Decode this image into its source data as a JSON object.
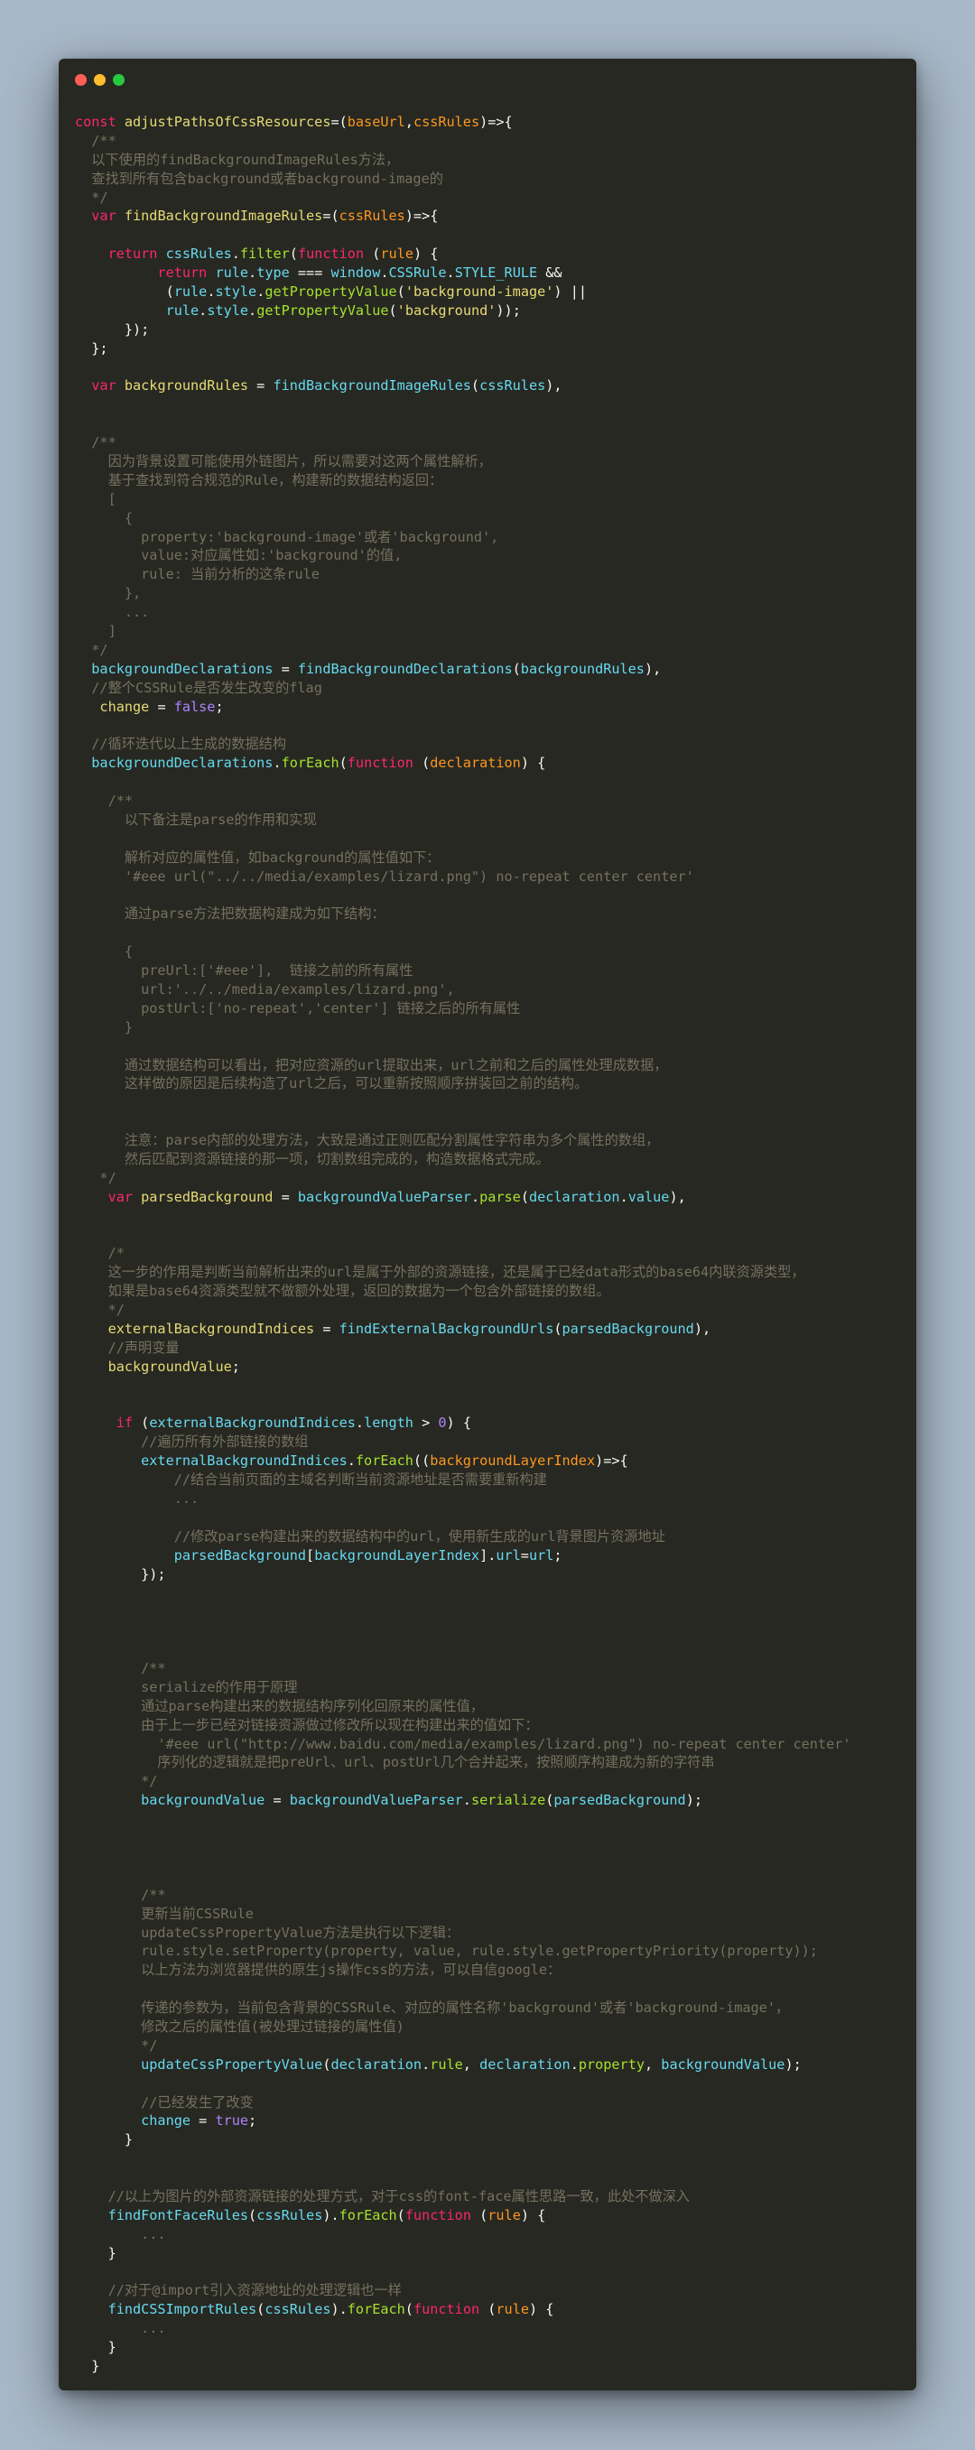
{
  "window": {
    "controls": [
      "close",
      "minimize",
      "maximize"
    ],
    "colors": {
      "close": "#ff5f56",
      "minimize": "#ffbd2e",
      "maximize": "#27c93f",
      "background": "#272822"
    }
  },
  "code": {
    "lines": [
      [
        [
          "kw",
          "const "
        ],
        [
          "ident",
          "adjustPathsOfCssResources"
        ],
        [
          "plain",
          "=("
        ],
        [
          "param",
          "baseUrl"
        ],
        [
          "plain",
          ","
        ],
        [
          "param",
          "cssRules"
        ],
        [
          "plain",
          ")=>{"
        ]
      ],
      [
        [
          "com",
          "  /**"
        ]
      ],
      [
        [
          "com",
          "  以下使用的findBackgroundImageRules方法，"
        ]
      ],
      [
        [
          "com",
          "  查找到所有包含background或者background-image的"
        ]
      ],
      [
        [
          "com",
          "  */"
        ]
      ],
      [
        [
          "kw",
          "  var "
        ],
        [
          "ident",
          "findBackgroundImageRules"
        ],
        [
          "plain",
          "=("
        ],
        [
          "param",
          "cssRules"
        ],
        [
          "plain",
          ")=>{"
        ]
      ],
      [],
      [
        [
          "kw",
          "    return "
        ],
        [
          "var",
          "cssRules"
        ],
        [
          "plain",
          "."
        ],
        [
          "fn",
          "filter"
        ],
        [
          "plain",
          "("
        ],
        [
          "kw",
          "function "
        ],
        [
          "plain",
          "("
        ],
        [
          "param",
          "rule"
        ],
        [
          "plain",
          ") {"
        ]
      ],
      [
        [
          "kw",
          "          return "
        ],
        [
          "var",
          "rule"
        ],
        [
          "plain",
          "."
        ],
        [
          "var",
          "type"
        ],
        [
          "plain",
          " === "
        ],
        [
          "var",
          "window"
        ],
        [
          "plain",
          "."
        ],
        [
          "var",
          "CSSRule"
        ],
        [
          "plain",
          "."
        ],
        [
          "var",
          "STYLE_RULE"
        ],
        [
          "plain",
          " &&"
        ]
      ],
      [
        [
          "plain",
          "           ("
        ],
        [
          "var",
          "rule"
        ],
        [
          "plain",
          "."
        ],
        [
          "var",
          "style"
        ],
        [
          "plain",
          "."
        ],
        [
          "fn",
          "getPropertyValue"
        ],
        [
          "plain",
          "("
        ],
        [
          "str",
          "'background-image'"
        ],
        [
          "plain",
          ") ||"
        ]
      ],
      [
        [
          "plain",
          "           "
        ],
        [
          "var",
          "rule"
        ],
        [
          "plain",
          "."
        ],
        [
          "var",
          "style"
        ],
        [
          "plain",
          "."
        ],
        [
          "fn",
          "getPropertyValue"
        ],
        [
          "plain",
          "("
        ],
        [
          "str",
          "'background'"
        ],
        [
          "plain",
          "));"
        ]
      ],
      [
        [
          "plain",
          "      });"
        ]
      ],
      [
        [
          "plain",
          "  };"
        ]
      ],
      [],
      [
        [
          "kw",
          "  var "
        ],
        [
          "ident",
          "backgroundRules"
        ],
        [
          "plain",
          " = "
        ],
        [
          "var",
          "findBackgroundImageRules"
        ],
        [
          "plain",
          "("
        ],
        [
          "var",
          "cssRules"
        ],
        [
          "plain",
          "),"
        ]
      ],
      [],
      [],
      [
        [
          "com",
          "  /**"
        ]
      ],
      [
        [
          "com",
          "    因为背景设置可能使用外链图片，所以需要对这两个属性解析，"
        ]
      ],
      [
        [
          "com",
          "    基于查找到符合规范的Rule，构建新的数据结构返回："
        ]
      ],
      [
        [
          "com",
          "    ["
        ]
      ],
      [
        [
          "com",
          "      {"
        ]
      ],
      [
        [
          "com",
          "        property:'background-image'或者'background',"
        ]
      ],
      [
        [
          "com",
          "        value:对应属性如:'background'的值,"
        ]
      ],
      [
        [
          "com",
          "        rule: 当前分析的这条rule"
        ]
      ],
      [
        [
          "com",
          "      },"
        ]
      ],
      [
        [
          "com",
          "      ..."
        ]
      ],
      [
        [
          "com",
          "    ]"
        ]
      ],
      [
        [
          "com",
          "  */"
        ]
      ],
      [
        [
          "var",
          "  backgroundDeclarations"
        ],
        [
          "plain",
          " = "
        ],
        [
          "var",
          "findBackgroundDeclarations"
        ],
        [
          "plain",
          "("
        ],
        [
          "var",
          "backgroundRules"
        ],
        [
          "plain",
          "),"
        ]
      ],
      [
        [
          "com",
          "  //整个CSSRule是否发生改变的flag"
        ]
      ],
      [
        [
          "ident",
          "   change"
        ],
        [
          "plain",
          " = "
        ],
        [
          "num",
          "false"
        ],
        [
          "plain",
          ";"
        ]
      ],
      [],
      [
        [
          "com",
          "  //循环迭代以上生成的数据结构"
        ]
      ],
      [
        [
          "var",
          "  backgroundDeclarations"
        ],
        [
          "plain",
          "."
        ],
        [
          "fn",
          "forEach"
        ],
        [
          "plain",
          "("
        ],
        [
          "kw",
          "function "
        ],
        [
          "plain",
          "("
        ],
        [
          "param",
          "declaration"
        ],
        [
          "plain",
          ") {"
        ]
      ],
      [],
      [
        [
          "com",
          "    /**"
        ]
      ],
      [
        [
          "com",
          "      以下备注是parse的作用和实现"
        ]
      ],
      [],
      [
        [
          "com",
          "      解析对应的属性值，如background的属性值如下："
        ]
      ],
      [
        [
          "com",
          "      '#eee url(\"../../media/examples/lizard.png\") no-repeat center center'"
        ]
      ],
      [],
      [
        [
          "com",
          "      通过parse方法把数据构建成为如下结构："
        ]
      ],
      [],
      [
        [
          "com",
          "      {"
        ]
      ],
      [
        [
          "com",
          "        preUrl:['#eee'],  链接之前的所有属性"
        ]
      ],
      [
        [
          "com",
          "        url:'../../media/examples/lizard.png',"
        ]
      ],
      [
        [
          "com",
          "        postUrl:['no-repeat','center'] 链接之后的所有属性"
        ]
      ],
      [
        [
          "com",
          "      }"
        ]
      ],
      [],
      [
        [
          "com",
          "      通过数据结构可以看出，把对应资源的url提取出来，url之前和之后的属性处理成数据，"
        ]
      ],
      [
        [
          "com",
          "      这样做的原因是后续构造了url之后，可以重新按照顺序拼装回之前的结构。"
        ]
      ],
      [],
      [],
      [
        [
          "com",
          "      注意：parse内部的处理方法，大致是通过正则匹配分割属性字符串为多个属性的数组，"
        ]
      ],
      [
        [
          "com",
          "      然后匹配到资源链接的那一项，切割数组完成的，构造数据格式完成。"
        ]
      ],
      [
        [
          "com",
          "   */"
        ]
      ],
      [
        [
          "kw",
          "    var "
        ],
        [
          "ident",
          "parsedBackground"
        ],
        [
          "plain",
          " = "
        ],
        [
          "var",
          "backgroundValueParser"
        ],
        [
          "plain",
          "."
        ],
        [
          "fn",
          "parse"
        ],
        [
          "plain",
          "("
        ],
        [
          "var",
          "declaration"
        ],
        [
          "plain",
          "."
        ],
        [
          "var",
          "value"
        ],
        [
          "plain",
          "),"
        ]
      ],
      [],
      [],
      [
        [
          "com",
          "    /*"
        ]
      ],
      [
        [
          "com",
          "    这一步的作用是判断当前解析出来的url是属于外部的资源链接，还是属于已经data形式的base64内联资源类型，"
        ]
      ],
      [
        [
          "com",
          "    如果是base64资源类型就不做额外处理，返回的数据为一个包含外部链接的数组。"
        ]
      ],
      [
        [
          "com",
          "    */"
        ]
      ],
      [
        [
          "ident",
          "    externalBackgroundIndices"
        ],
        [
          "plain",
          " = "
        ],
        [
          "var",
          "findExternalBackgroundUrls"
        ],
        [
          "plain",
          "("
        ],
        [
          "var",
          "parsedBackground"
        ],
        [
          "plain",
          "),"
        ]
      ],
      [
        [
          "com",
          "    //声明变量"
        ]
      ],
      [
        [
          "ident",
          "    backgroundValue"
        ],
        [
          "plain",
          ";"
        ]
      ],
      [],
      [],
      [
        [
          "kw",
          "     if "
        ],
        [
          "plain",
          "("
        ],
        [
          "var",
          "externalBackgroundIndices"
        ],
        [
          "plain",
          "."
        ],
        [
          "var",
          "length"
        ],
        [
          "plain",
          " > "
        ],
        [
          "num",
          "0"
        ],
        [
          "plain",
          ") {"
        ]
      ],
      [
        [
          "com",
          "        //遍历所有外部链接的数组"
        ]
      ],
      [
        [
          "var",
          "        externalBackgroundIndices"
        ],
        [
          "plain",
          "."
        ],
        [
          "fn",
          "forEach"
        ],
        [
          "plain",
          "(("
        ],
        [
          "param",
          "backgroundLayerIndex"
        ],
        [
          "plain",
          ")=>{"
        ]
      ],
      [
        [
          "com",
          "            //结合当前页面的主域名判断当前资源地址是否需要重新构建"
        ]
      ],
      [
        [
          "com",
          "            ..."
        ]
      ],
      [],
      [
        [
          "com",
          "            //修改parse构建出来的数据结构中的url，使用新生成的url背景图片资源地址"
        ]
      ],
      [
        [
          "var",
          "            parsedBackground"
        ],
        [
          "plain",
          "["
        ],
        [
          "var",
          "backgroundLayerIndex"
        ],
        [
          "plain",
          "]."
        ],
        [
          "var",
          "url"
        ],
        [
          "plain",
          "="
        ],
        [
          "var",
          "url"
        ],
        [
          "plain",
          ";"
        ]
      ],
      [
        [
          "plain",
          "        });"
        ]
      ],
      [],
      [],
      [],
      [],
      [
        [
          "com",
          "        /**"
        ]
      ],
      [
        [
          "com",
          "        serialize的作用于原理"
        ]
      ],
      [
        [
          "com",
          "        通过parse构建出来的数据结构序列化回原来的属性值，"
        ]
      ],
      [
        [
          "com",
          "        由于上一步已经对链接资源做过修改所以现在构建出来的值如下："
        ]
      ],
      [
        [
          "com",
          "          '#eee url(\"http://www.baidu.com/media/examples/lizard.png\") no-repeat center center'"
        ]
      ],
      [
        [
          "com",
          "          序列化的逻辑就是把preUrl、url、postUrl几个合并起来，按照顺序构建成为新的字符串"
        ]
      ],
      [
        [
          "com",
          "        */"
        ]
      ],
      [
        [
          "var",
          "        backgroundValue"
        ],
        [
          "plain",
          " = "
        ],
        [
          "var",
          "backgroundValueParser"
        ],
        [
          "plain",
          "."
        ],
        [
          "fn",
          "serialize"
        ],
        [
          "plain",
          "("
        ],
        [
          "var",
          "parsedBackground"
        ],
        [
          "plain",
          ");"
        ]
      ],
      [],
      [],
      [],
      [],
      [
        [
          "com",
          "        /**"
        ]
      ],
      [
        [
          "com",
          "        更新当前CSSRule"
        ]
      ],
      [
        [
          "com",
          "        updateCssPropertyValue方法是执行以下逻辑："
        ]
      ],
      [
        [
          "com",
          "        rule.style.setProperty(property, value, rule.style.getPropertyPriority(property));"
        ]
      ],
      [
        [
          "com",
          "        以上方法为浏览器提供的原生js操作css的方法，可以自信google："
        ]
      ],
      [],
      [
        [
          "com",
          "        传递的参数为，当前包含背景的CSSRule、对应的属性名称'background'或者'background-image'，"
        ]
      ],
      [
        [
          "com",
          "        修改之后的属性值(被处理过链接的属性值)"
        ]
      ],
      [
        [
          "com",
          "        */"
        ]
      ],
      [
        [
          "var",
          "        updateCssPropertyValue"
        ],
        [
          "plain",
          "("
        ],
        [
          "var",
          "declaration"
        ],
        [
          "plain",
          "."
        ],
        [
          "fn",
          "rule"
        ],
        [
          "plain",
          ", "
        ],
        [
          "var",
          "declaration"
        ],
        [
          "plain",
          "."
        ],
        [
          "fn",
          "property"
        ],
        [
          "plain",
          ", "
        ],
        [
          "var",
          "backgroundValue"
        ],
        [
          "plain",
          ");"
        ]
      ],
      [],
      [
        [
          "com",
          "        //已经发生了改变"
        ]
      ],
      [
        [
          "var",
          "        change"
        ],
        [
          "plain",
          " = "
        ],
        [
          "num",
          "true"
        ],
        [
          "plain",
          ";"
        ]
      ],
      [
        [
          "plain",
          "      }"
        ]
      ],
      [],
      [],
      [
        [
          "com",
          "    //以上为图片的外部资源链接的处理方式，对于css的font-face属性思路一致，此处不做深入"
        ]
      ],
      [
        [
          "var",
          "    findFontFaceRules"
        ],
        [
          "plain",
          "("
        ],
        [
          "var",
          "cssRules"
        ],
        [
          "plain",
          ")."
        ],
        [
          "fn",
          "forEach"
        ],
        [
          "plain",
          "("
        ],
        [
          "kw",
          "function "
        ],
        [
          "plain",
          "("
        ],
        [
          "param",
          "rule"
        ],
        [
          "plain",
          ") {"
        ]
      ],
      [
        [
          "com",
          "        ..."
        ]
      ],
      [
        [
          "plain",
          "    }"
        ]
      ],
      [],
      [
        [
          "com",
          "    //对于@import引入资源地址的处理逻辑也一样"
        ]
      ],
      [
        [
          "var",
          "    findCSSImportRules"
        ],
        [
          "plain",
          "("
        ],
        [
          "var",
          "cssRules"
        ],
        [
          "plain",
          ")."
        ],
        [
          "fn",
          "forEach"
        ],
        [
          "plain",
          "("
        ],
        [
          "kw",
          "function "
        ],
        [
          "plain",
          "("
        ],
        [
          "param",
          "rule"
        ],
        [
          "plain",
          ") {"
        ]
      ],
      [
        [
          "com",
          "        ..."
        ]
      ],
      [
        [
          "plain",
          "    }"
        ]
      ],
      [
        [
          "plain",
          "  }"
        ]
      ],
      [],
      [
        [
          "plain",
          "}"
        ]
      ]
    ]
  }
}
